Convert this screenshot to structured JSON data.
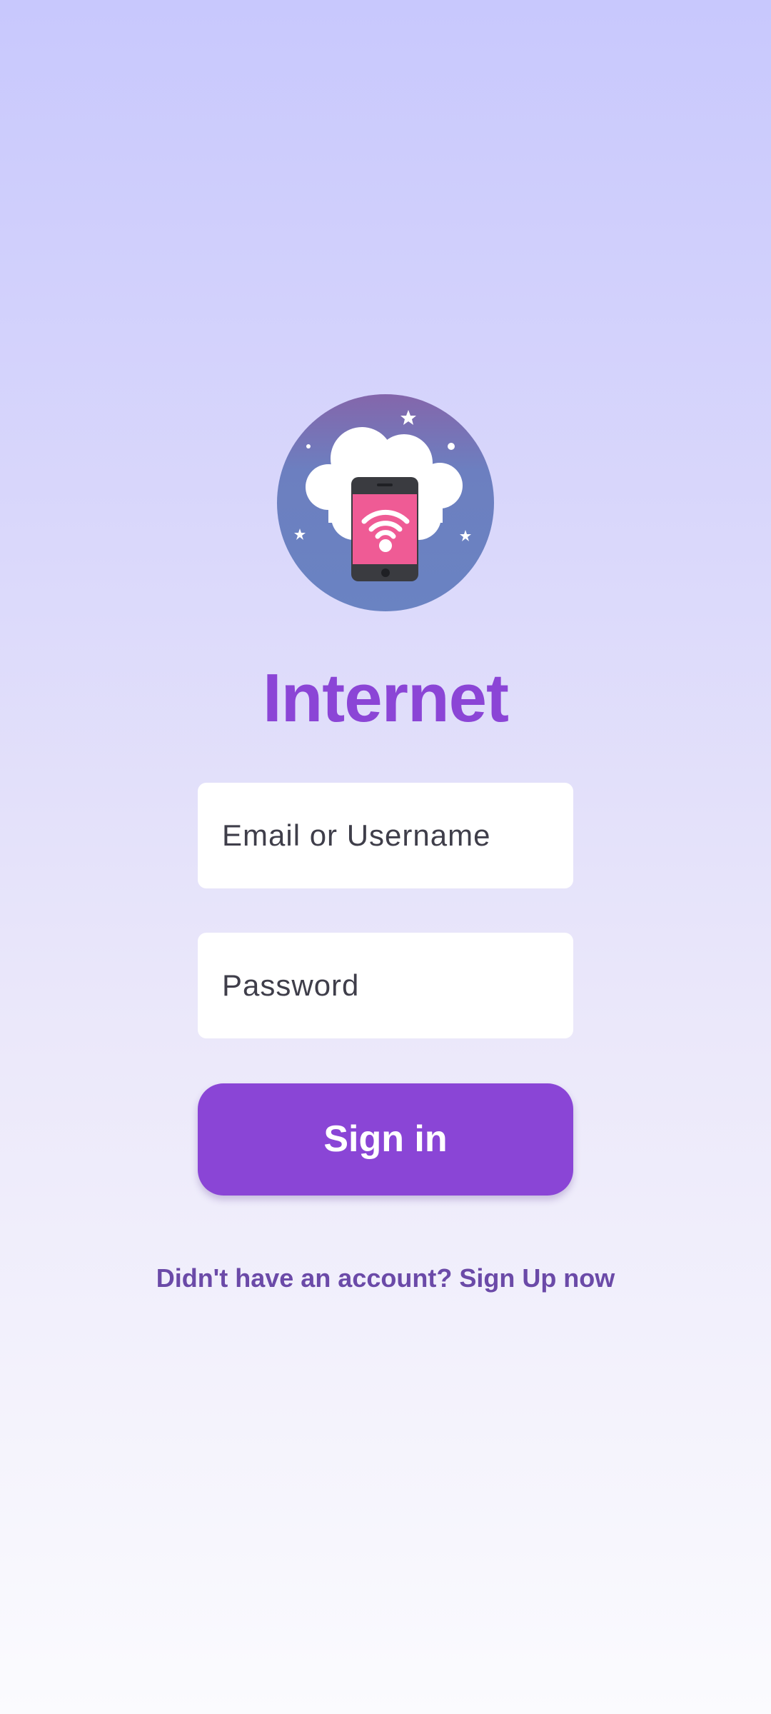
{
  "app": {
    "title": "Internet",
    "logo_icon": "cloud-smartphone-wifi-icon"
  },
  "login_form": {
    "email": {
      "value": "",
      "placeholder": "Email or Username"
    },
    "password": {
      "value": "",
      "placeholder": "Password"
    },
    "signin_label": "Sign in"
  },
  "footer": {
    "signup_text": "Didn't have an account? Sign Up now"
  },
  "colors": {
    "accent": "#8a45d6",
    "link": "#6b4aa8",
    "background_top": "#c8c8fd",
    "background_bottom": "#fbfbfe",
    "logo_circle_top": "#8466ab",
    "logo_circle_bottom": "#6a83c2",
    "phone_screen": "#ef5b95",
    "phone_body": "#3a3b40"
  }
}
